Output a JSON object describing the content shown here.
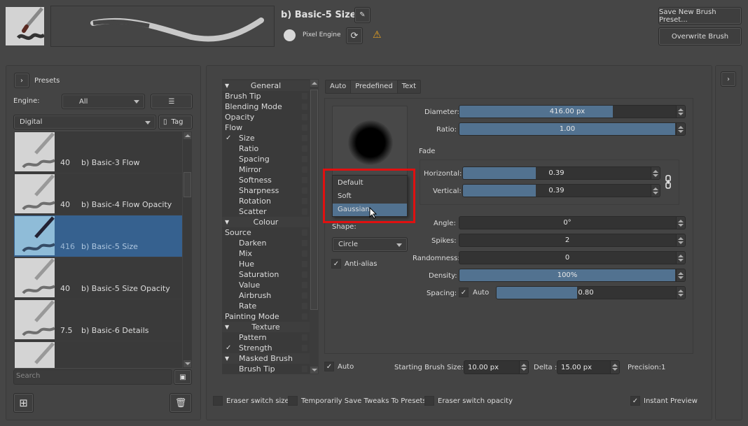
{
  "header": {
    "preset_name": "b) Basic-5 Size",
    "engine_label": "Pixel Engine",
    "save_new_label": "Save New Brush Preset...",
    "overwrite_label": "Overwrite Brush",
    "icons": {
      "edit": "pencil-icon",
      "reload": "reload-icon",
      "warning": "warning-icon"
    }
  },
  "presets": {
    "title": "Presets",
    "engine_label": "Engine:",
    "engine_value": "All",
    "tag_value": "Digital",
    "tag_button": "Tag",
    "search_placeholder": "Search",
    "items": [
      {
        "size": "40",
        "name": "b) Basic-3 Flow",
        "selected": false
      },
      {
        "size": "40",
        "name": "b) Basic-4 Flow Opacity",
        "selected": false
      },
      {
        "size": "416",
        "name": "b) Basic-5 Size",
        "selected": true
      },
      {
        "size": "40",
        "name": "b) Basic-5 Size Opacity",
        "selected": false
      },
      {
        "size": "7.5",
        "name": "b) Basic-6 Details",
        "selected": false
      },
      {
        "size": "",
        "name": "",
        "selected": false
      }
    ]
  },
  "options": [
    {
      "label": "General",
      "type": "header"
    },
    {
      "label": "Brush Tip",
      "type": "item",
      "indent": 0
    },
    {
      "label": "Blending Mode",
      "type": "item",
      "indent": 0
    },
    {
      "label": "Opacity",
      "type": "item",
      "indent": 0
    },
    {
      "label": "Flow",
      "type": "item",
      "indent": 0
    },
    {
      "label": "Size",
      "type": "item",
      "indent": 1,
      "checked": true
    },
    {
      "label": "Ratio",
      "type": "item",
      "indent": 1
    },
    {
      "label": "Spacing",
      "type": "item",
      "indent": 1
    },
    {
      "label": "Mirror",
      "type": "item",
      "indent": 1
    },
    {
      "label": "Softness",
      "type": "item",
      "indent": 1
    },
    {
      "label": "Sharpness",
      "type": "item",
      "indent": 1
    },
    {
      "label": "Rotation",
      "type": "item",
      "indent": 1
    },
    {
      "label": "Scatter",
      "type": "item",
      "indent": 1
    },
    {
      "label": "Colour",
      "type": "header"
    },
    {
      "label": "Source",
      "type": "item",
      "indent": 0
    },
    {
      "label": "Darken",
      "type": "item",
      "indent": 1
    },
    {
      "label": "Mix",
      "type": "item",
      "indent": 1
    },
    {
      "label": "Hue",
      "type": "item",
      "indent": 1
    },
    {
      "label": "Saturation",
      "type": "item",
      "indent": 1
    },
    {
      "label": "Value",
      "type": "item",
      "indent": 1
    },
    {
      "label": "Airbrush",
      "type": "item",
      "indent": 1
    },
    {
      "label": "Rate",
      "type": "item",
      "indent": 1
    },
    {
      "label": "Painting Mode",
      "type": "item",
      "indent": 0
    },
    {
      "label": "Texture",
      "type": "header"
    },
    {
      "label": "Pattern",
      "type": "item",
      "indent": 1
    },
    {
      "label": "Strength",
      "type": "item",
      "indent": 1,
      "checked": true
    },
    {
      "label": "Masked Brush",
      "type": "header"
    },
    {
      "label": "Brush Tip",
      "type": "item",
      "indent": 1
    }
  ],
  "tip": {
    "tabs": [
      "Auto",
      "Predefined",
      "Text"
    ],
    "dropdown_options": [
      "Default",
      "Soft",
      "Gaussian"
    ],
    "dropdown_selected": "Gaussian",
    "shape_label": "Shape:",
    "shape_value": "Circle",
    "antialias_label": "Anti-alias",
    "antialias_checked": true,
    "diameter": {
      "label": "Diameter:",
      "value": "416.00 px",
      "fill": 0.71
    },
    "ratio": {
      "label": "Ratio:",
      "value": "1.00",
      "fill": 1.0
    },
    "fade_label": "Fade",
    "horizontal": {
      "label": "Horizontal:",
      "value": "0.39",
      "fill": 0.39
    },
    "vertical": {
      "label": "Vertical:",
      "value": "0.39",
      "fill": 0.39
    },
    "angle": {
      "label": "Angle:",
      "value": "0°",
      "fill": 0
    },
    "spikes": {
      "label": "Spikes:",
      "value": "2",
      "fill": 0
    },
    "randomness": {
      "label": "Randomness:",
      "value": "0",
      "fill": 0
    },
    "density": {
      "label": "Density:",
      "value": "100%",
      "fill": 1.0
    },
    "spacing": {
      "label": "Spacing:",
      "auto_label": "Auto",
      "value": "0.80",
      "fill": 0.45
    }
  },
  "bottom": {
    "auto_label": "Auto",
    "start_size_label": "Starting Brush Size:",
    "start_size_value": "10.00 px",
    "delta_label": "Delta :",
    "delta_value": "15.00 px",
    "precision_label": "Precision:1"
  },
  "footer": {
    "eraser_size": "Eraser switch size",
    "temp_save": "Temporarily Save Tweaks To Presets",
    "eraser_opacity": "Eraser switch opacity",
    "instant_preview": "Instant Preview"
  },
  "colors": {
    "accent": "#527290",
    "selected_row": "#36618f",
    "highlight_box": "#e01010",
    "warning": "#e6a020"
  }
}
